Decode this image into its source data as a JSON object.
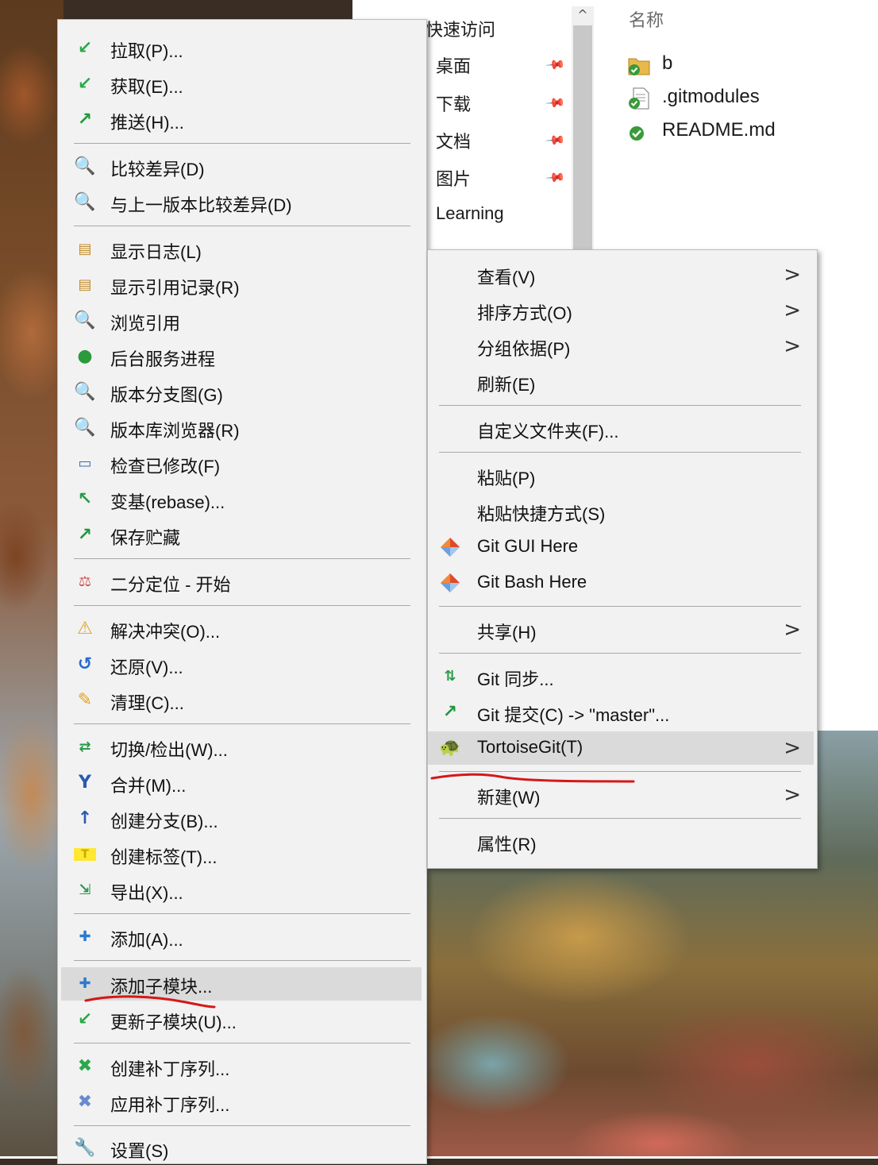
{
  "explorer": {
    "nav": {
      "quick_access": "快速访问",
      "items": [
        {
          "label": "桌面",
          "pinned": true
        },
        {
          "label": "下载",
          "pinned": true
        },
        {
          "label": "文档",
          "pinned": true
        },
        {
          "label": "图片",
          "pinned": true
        },
        {
          "label": "Learning",
          "pinned": false
        }
      ]
    },
    "file_list": {
      "column_header": "名称",
      "files": [
        {
          "name": "b",
          "icon": "folder-git-icon"
        },
        {
          "name": ".gitmodules",
          "icon": "document-git-icon"
        },
        {
          "name": "README.md",
          "icon": "git-ok-icon"
        }
      ]
    }
  },
  "main_menu": {
    "items": [
      {
        "label": "查看(V)",
        "submenu": true
      },
      {
        "label": "排序方式(O)",
        "submenu": true
      },
      {
        "label": "分组依据(P)",
        "submenu": true
      },
      {
        "label": "刷新(E)",
        "submenu": false
      },
      {
        "label": "自定义文件夹(F)..."
      },
      {
        "label": "粘贴(P)"
      },
      {
        "label": "粘贴快捷方式(S)"
      },
      {
        "label": "Git GUI Here",
        "icon": "git-diamond-icon"
      },
      {
        "label": "Git Bash Here",
        "icon": "git-diamond-icon"
      },
      {
        "label": "共享(H)",
        "submenu": true
      },
      {
        "label": "Git 同步...",
        "icon": "git-sync-icon"
      },
      {
        "label": "Git 提交(C) -> \"master\"...",
        "icon": "git-commit-arrow-icon"
      },
      {
        "label": "TortoiseGit(T)",
        "icon": "tortoisegit-icon",
        "submenu": true,
        "highlighted": true
      },
      {
        "label": "新建(W)",
        "submenu": true
      },
      {
        "label": "属性(R)"
      }
    ]
  },
  "tortoisegit_menu": {
    "items": [
      {
        "label": "拉取(P)...",
        "icon": "pull-arrow-icon"
      },
      {
        "label": "获取(E)...",
        "icon": "fetch-arrow-icon"
      },
      {
        "label": "推送(H)...",
        "icon": "push-arrow-icon"
      },
      {
        "label": "比较差异(D)",
        "icon": "magnifier-icon"
      },
      {
        "label": "与上一版本比较差异(D)",
        "icon": "magnifier-icon"
      },
      {
        "label": "显示日志(L)",
        "icon": "log-icon"
      },
      {
        "label": "显示引用记录(R)",
        "icon": "reflog-icon"
      },
      {
        "label": "浏览引用",
        "icon": "browse-refs-icon"
      },
      {
        "label": "后台服务进程",
        "icon": "globe-icon"
      },
      {
        "label": "版本分支图(G)",
        "icon": "revision-graph-icon"
      },
      {
        "label": "版本库浏览器(R)",
        "icon": "repo-browser-icon"
      },
      {
        "label": "检查已修改(F)",
        "icon": "check-modifications-icon"
      },
      {
        "label": "变基(rebase)...",
        "icon": "rebase-icon"
      },
      {
        "label": "保存贮藏",
        "icon": "stash-icon"
      },
      {
        "label": "二分定位 - 开始",
        "icon": "bisect-icon"
      },
      {
        "label": "解决冲突(O)...",
        "icon": "resolve-conflict-icon"
      },
      {
        "label": "还原(V)...",
        "icon": "revert-icon"
      },
      {
        "label": "清理(C)...",
        "icon": "cleanup-icon"
      },
      {
        "label": "切换/检出(W)...",
        "icon": "switch-checkout-icon"
      },
      {
        "label": "合并(M)...",
        "icon": "merge-icon"
      },
      {
        "label": "创建分支(B)...",
        "icon": "branch-icon"
      },
      {
        "label": "创建标签(T)...",
        "icon": "tag-icon"
      },
      {
        "label": "导出(X)...",
        "icon": "export-icon"
      },
      {
        "label": "添加(A)...",
        "icon": "add-plus-icon"
      },
      {
        "label": "添加子模块...",
        "icon": "add-submodule-icon",
        "highlighted": true
      },
      {
        "label": "更新子模块(U)...",
        "icon": "update-submodule-icon"
      },
      {
        "label": "创建补丁序列...",
        "icon": "create-patch-icon"
      },
      {
        "label": "应用补丁序列...",
        "icon": "apply-patch-icon"
      },
      {
        "label": "设置(S)",
        "icon": "settings-wrench-icon"
      }
    ]
  },
  "colors": {
    "menu_bg": "#f2f2f2",
    "menu_highlight": "#dadada",
    "annotation_red": "#d41818"
  }
}
